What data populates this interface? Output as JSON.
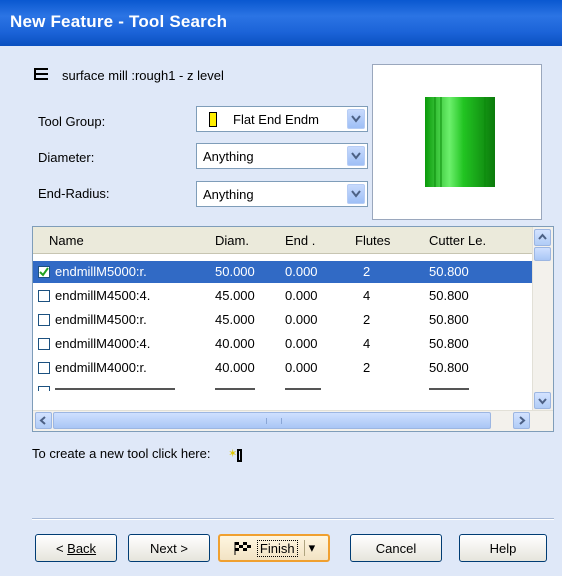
{
  "window": {
    "title": "New Feature - Tool Search"
  },
  "operation": {
    "label": "surface mill :rough1 - z level",
    "icon": "operation-icon"
  },
  "filters": {
    "tool_group": {
      "label": "Tool Group:",
      "value": "Flat End Endm"
    },
    "diameter": {
      "label": "Diameter:",
      "value": "Anything"
    },
    "end_radius": {
      "label": "End-Radius:",
      "value": "Anything"
    }
  },
  "preview": {
    "icon": "tool-preview-cylinder",
    "color": "#22c422"
  },
  "table": {
    "columns": [
      "Name",
      "Diam.",
      "End .",
      "Flutes",
      "Cutter Le."
    ],
    "rows": [
      {
        "checked": true,
        "name": "endmillM5000:r.",
        "diam": "50.000",
        "end": "0.000",
        "flutes": "2",
        "length": "50.800"
      },
      {
        "checked": false,
        "name": "endmillM4500:4.",
        "diam": "45.000",
        "end": "0.000",
        "flutes": "4",
        "length": "50.800"
      },
      {
        "checked": false,
        "name": "endmillM4500:r.",
        "diam": "45.000",
        "end": "0.000",
        "flutes": "2",
        "length": "50.800"
      },
      {
        "checked": false,
        "name": "endmillM4000:4.",
        "diam": "40.000",
        "end": "0.000",
        "flutes": "4",
        "length": "50.800"
      },
      {
        "checked": false,
        "name": "endmillM4000:r.",
        "diam": "40.000",
        "end": "0.000",
        "flutes": "2",
        "length": "50.800"
      }
    ]
  },
  "new_tool": {
    "label": "To create a new tool click here:"
  },
  "buttons": {
    "back": "Back",
    "next": "Next >",
    "finish": "Finish",
    "cancel": "Cancel",
    "help": "Help"
  },
  "colors": {
    "title_bar": "#0a58d0",
    "selection": "#316ac5",
    "frame": "#dfe8f8"
  }
}
